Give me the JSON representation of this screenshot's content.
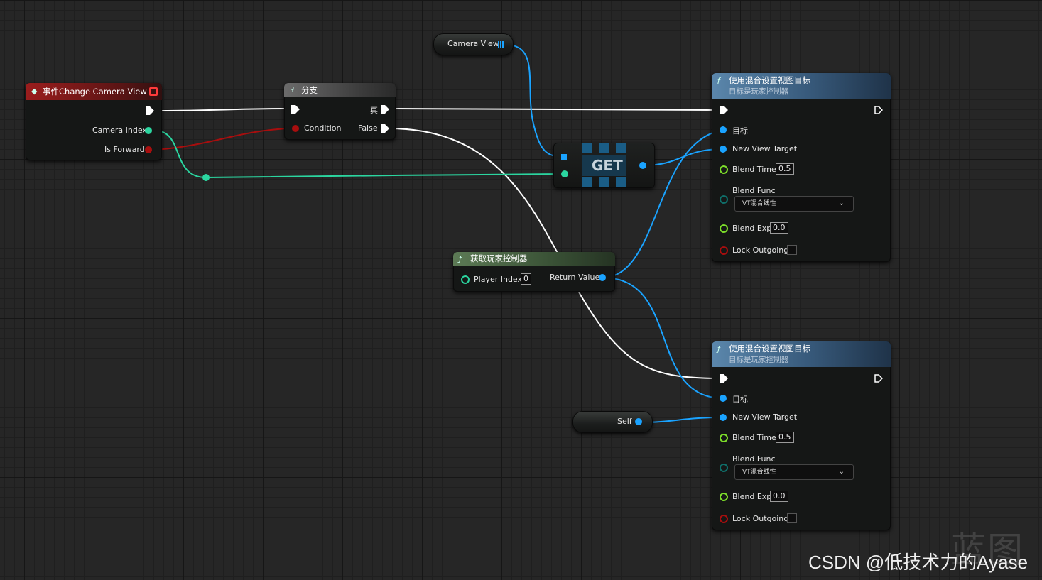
{
  "colors": {
    "exec": "#ffffff",
    "int": "#2bd6a0",
    "bool": "#a80e0e",
    "object": "#1aa3ff",
    "float": "#7dde2a",
    "byte": "#0f6f6a"
  },
  "event_node": {
    "title": "事件Change Camera View",
    "pins": [
      "Camera Index",
      "Is Forward"
    ]
  },
  "branch_node": {
    "title": "分支",
    "condition": "Condition",
    "true_label": "真",
    "false_label": "False"
  },
  "camera_view_var": {
    "label": "Camera View"
  },
  "get_node": {
    "label": "GET"
  },
  "get_player_controller": {
    "title": "获取玩家控制器",
    "player_index_label": "Player Index",
    "player_index_value": "0",
    "return_label": "Return Value"
  },
  "self_node": {
    "label": "Self"
  },
  "blend_nodes": [
    {
      "title": "使用混合设置视图目标",
      "subtitle": "目标是玩家控制器",
      "target": "目标",
      "new_view_target": "New View Target",
      "blend_time_label": "Blend Time",
      "blend_time_value": "0.5",
      "blend_func_label": "Blend Func",
      "blend_func_value": "VT混合线性",
      "blend_exp_label": "Blend Exp",
      "blend_exp_value": "0.0",
      "lock_outgoing_label": "Lock Outgoing"
    },
    {
      "title": "使用混合设置视图目标",
      "subtitle": "目标是玩家控制器",
      "target": "目标",
      "new_view_target": "New View Target",
      "blend_time_label": "Blend Time",
      "blend_time_value": "0.5",
      "blend_func_label": "Blend Func",
      "blend_func_value": "VT混合线性",
      "blend_exp_label": "Blend Exp",
      "blend_exp_value": "0.0",
      "lock_outgoing_label": "Lock Outgoing"
    }
  ],
  "watermark": {
    "text": "CSDN @低技术力的Ayase",
    "logo_text": "蓝图"
  }
}
